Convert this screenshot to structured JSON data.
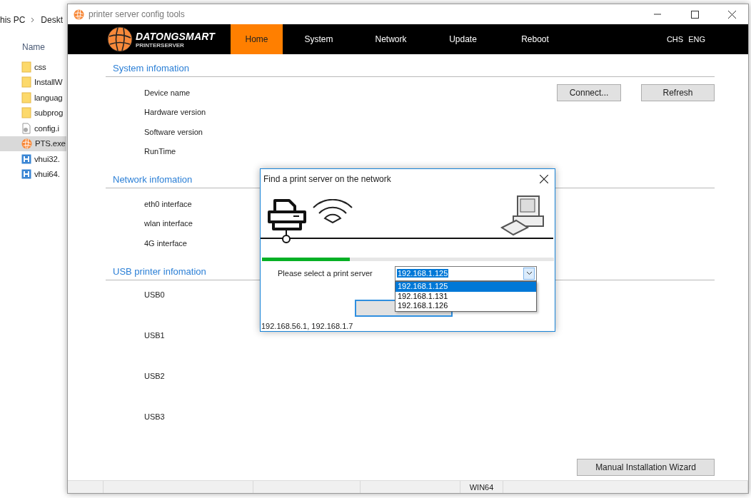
{
  "explorer": {
    "breadcrumb": [
      "his PC",
      "Deskt"
    ],
    "column_header": "Name",
    "files": [
      {
        "name": "css",
        "kind": "folder",
        "selected": false
      },
      {
        "name": "InstallW",
        "kind": "folder",
        "selected": false
      },
      {
        "name": "languag",
        "kind": "folder",
        "selected": false
      },
      {
        "name": "subprog",
        "kind": "folder",
        "selected": false
      },
      {
        "name": "config.i",
        "kind": "config",
        "selected": false
      },
      {
        "name": "PTS.exe",
        "kind": "app",
        "selected": true
      },
      {
        "name": "vhui32.",
        "kind": "library",
        "selected": false
      },
      {
        "name": "vhui64.",
        "kind": "library",
        "selected": false
      }
    ]
  },
  "window": {
    "title": "printer server config tools"
  },
  "header": {
    "brand": "DATONGSMART",
    "subtitle": "PRINTERSERVER",
    "nav": [
      {
        "label": "Home",
        "selected": true
      },
      {
        "label": "System",
        "selected": false
      },
      {
        "label": "Network",
        "selected": false
      },
      {
        "label": "Update",
        "selected": false
      },
      {
        "label": "Reboot",
        "selected": false
      }
    ],
    "languages": [
      "CHS",
      "ENG"
    ]
  },
  "sections": [
    {
      "title": "System infomation",
      "kind": "info",
      "rows": [
        "Device name",
        "Hardware version",
        "Software version",
        "RunTime"
      ],
      "buttons": [
        "Connect...",
        "Refresh"
      ]
    },
    {
      "title": "Network infomation",
      "kind": "info",
      "rows": [
        "eth0 interface",
        "wlan interface",
        "4G interface"
      ]
    },
    {
      "title": "USB printer infomation",
      "kind": "usb",
      "rows": [
        "USB0",
        "USB1",
        "USB2",
        "USB3"
      ]
    }
  ],
  "wizard_button": "Manual Installation Wizard",
  "status_bar": {
    "text": "WIN64"
  },
  "dialog": {
    "title": "Find a print server on the network",
    "progress": {
      "level": 0.3
    },
    "label": "Please select a print server",
    "combo_value": "192.168.1.125",
    "options": [
      {
        "label": "192.168.1.125",
        "selected": true
      },
      {
        "label": "192.168.1.131",
        "selected": false
      },
      {
        "label": "192.168.1.126",
        "selected": false
      }
    ],
    "hosts": "192.168.56.1, 192.168.1.7"
  }
}
